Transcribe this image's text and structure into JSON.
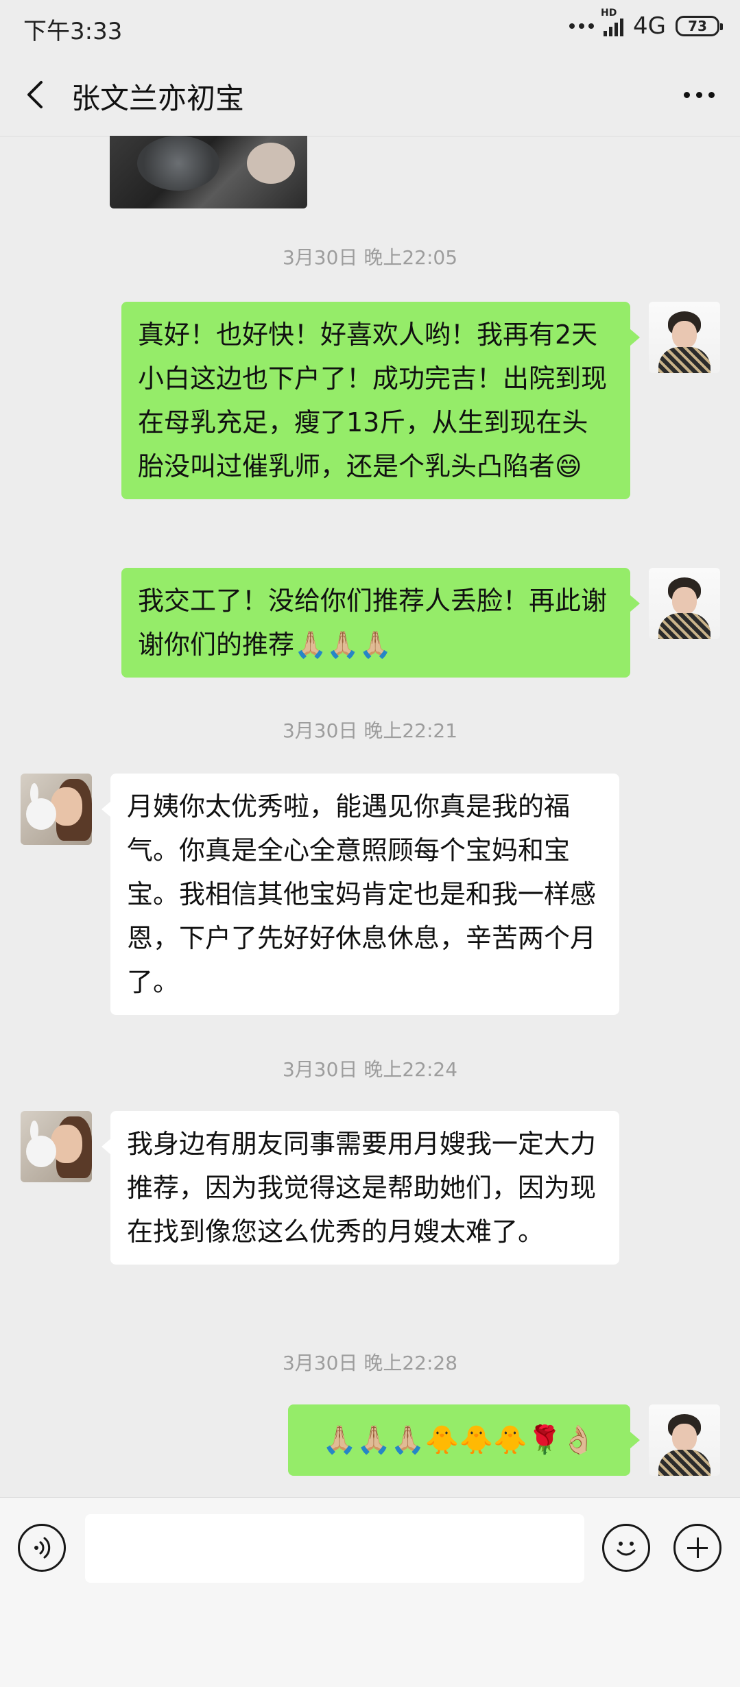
{
  "status_bar": {
    "time": "下午3:33",
    "network": "4G",
    "hd": "HD",
    "battery": "73"
  },
  "header": {
    "title": "张文兰亦初宝",
    "back_icon": "back-arrow-icon",
    "more_icon": "more-dots-icon"
  },
  "messages": [
    {
      "type": "timestamp",
      "text": "3月30日 晚上22:05"
    },
    {
      "type": "sent",
      "text": "真好！也好快！好喜欢人哟！我再有2天小白这边也下户了！成功完吉！出院到现在母乳充足，瘦了13斤，从生到现在头胎没叫过催乳师，还是个乳头凸陷者😄"
    },
    {
      "type": "sent",
      "text": "我交工了！没给你们推荐人丢脸！再此谢谢你们的推荐🙏🏼🙏🏼🙏🏼"
    },
    {
      "type": "timestamp",
      "text": "3月30日 晚上22:21"
    },
    {
      "type": "received",
      "text": "月姨你太优秀啦，能遇见你真是我的福气。你真是全心全意照顾每个宝妈和宝宝。我相信其他宝妈肯定也是和我一样感恩，下户了先好好休息休息，辛苦两个月了。"
    },
    {
      "type": "timestamp",
      "text": "3月30日 晚上22:24"
    },
    {
      "type": "received",
      "text": "我身边有朋友同事需要用月嫂我一定大力推荐，因为我觉得这是帮助她们，因为现在找到像您这么优秀的月嫂太难了。"
    },
    {
      "type": "timestamp",
      "text": "3月30日 晚上22:28"
    },
    {
      "type": "sent",
      "text": "🙏🏼🙏🏼🙏🏼🐥🐥🐥🌹👌🏼"
    }
  ],
  "input_bar": {
    "voice_icon": "voice-icon",
    "input_value": "",
    "emoji_icon": "smiley-icon",
    "plus_icon": "plus-icon"
  },
  "colors": {
    "background": "#ededed",
    "sent_bubble": "#95ec69",
    "received_bubble": "#ffffff",
    "timestamp": "#9d9d9d"
  }
}
